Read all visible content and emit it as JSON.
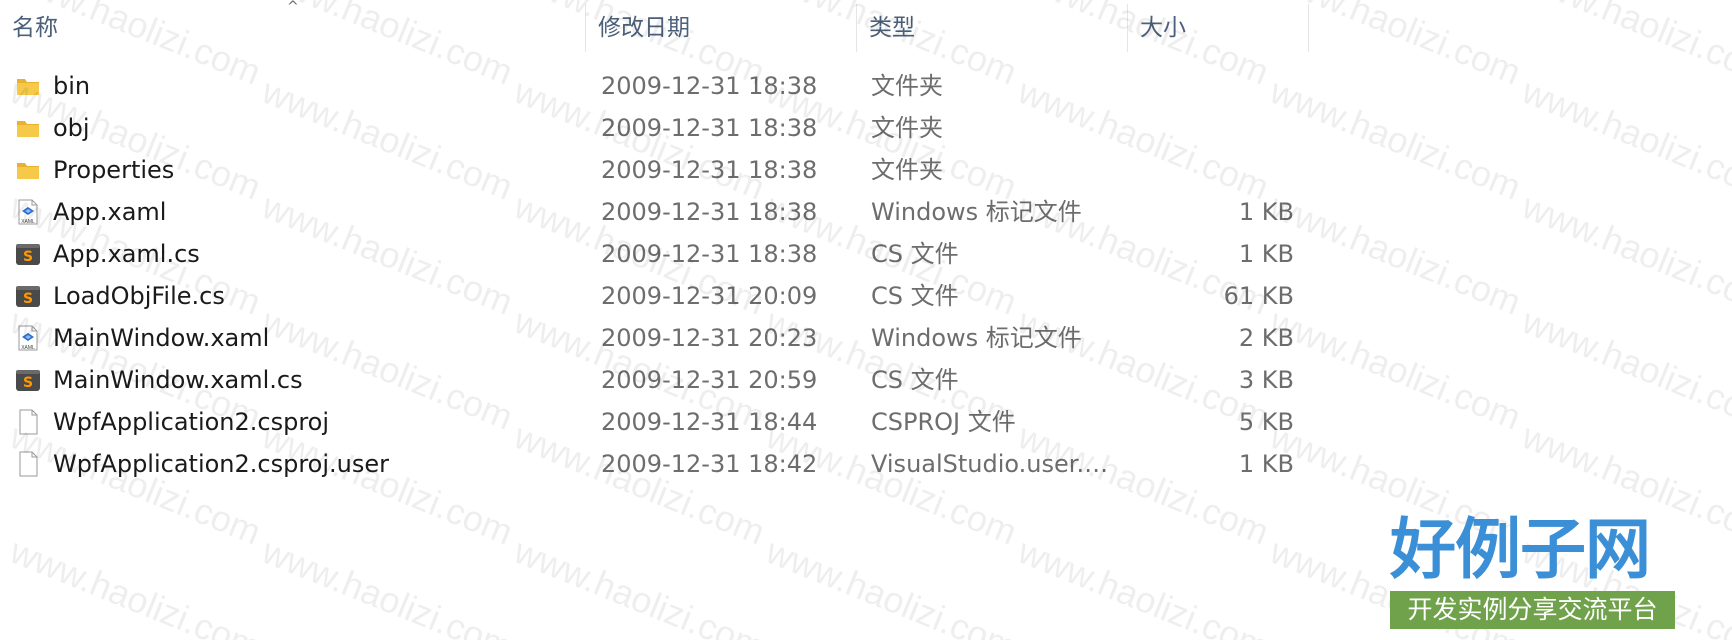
{
  "columns": {
    "name": "名称",
    "date": "修改日期",
    "type": "类型",
    "size": "大小"
  },
  "sort": {
    "column": "name",
    "direction": "ascending",
    "indicator": "^"
  },
  "files": [
    {
      "name": "bin",
      "date": "2009-12-31 18:38",
      "type": "文件夹",
      "size": "",
      "icon": "folder-icon"
    },
    {
      "name": "obj",
      "date": "2009-12-31 18:38",
      "type": "文件夹",
      "size": "",
      "icon": "folder-icon"
    },
    {
      "name": "Properties",
      "date": "2009-12-31 18:38",
      "type": "文件夹",
      "size": "",
      "icon": "folder-icon"
    },
    {
      "name": "App.xaml",
      "date": "2009-12-31 18:38",
      "type": "Windows 标记文件",
      "size": "1 KB",
      "icon": "xaml-file-icon"
    },
    {
      "name": "App.xaml.cs",
      "date": "2009-12-31 18:38",
      "type": "CS 文件",
      "size": "1 KB",
      "icon": "sublime-file-icon"
    },
    {
      "name": "LoadObjFile.cs",
      "date": "2009-12-31 20:09",
      "type": "CS 文件",
      "size": "61 KB",
      "icon": "sublime-file-icon"
    },
    {
      "name": "MainWindow.xaml",
      "date": "2009-12-31 20:23",
      "type": "Windows 标记文件",
      "size": "2 KB",
      "icon": "xaml-file-icon"
    },
    {
      "name": "MainWindow.xaml.cs",
      "date": "2009-12-31 20:59",
      "type": "CS 文件",
      "size": "3 KB",
      "icon": "sublime-file-icon"
    },
    {
      "name": "WpfApplication2.csproj",
      "date": "2009-12-31 18:44",
      "type": "CSPROJ 文件",
      "size": "5 KB",
      "icon": "blank-file-icon"
    },
    {
      "name": "WpfApplication2.csproj.user",
      "date": "2009-12-31 18:42",
      "type": "VisualStudio.user.a...",
      "size": "1 KB",
      "icon": "blank-file-icon"
    }
  ],
  "watermark": {
    "text": "www.haolizi.com"
  },
  "logo": {
    "title": "好例子网",
    "tagline": "开发实例分享交流平台"
  },
  "colors": {
    "folder": "#f7c948",
    "sublime": "#4a4a4a",
    "sublime_accent": "#ff9800",
    "logo_blue": "#3a8fd6",
    "logo_green": "#6fa24a"
  }
}
